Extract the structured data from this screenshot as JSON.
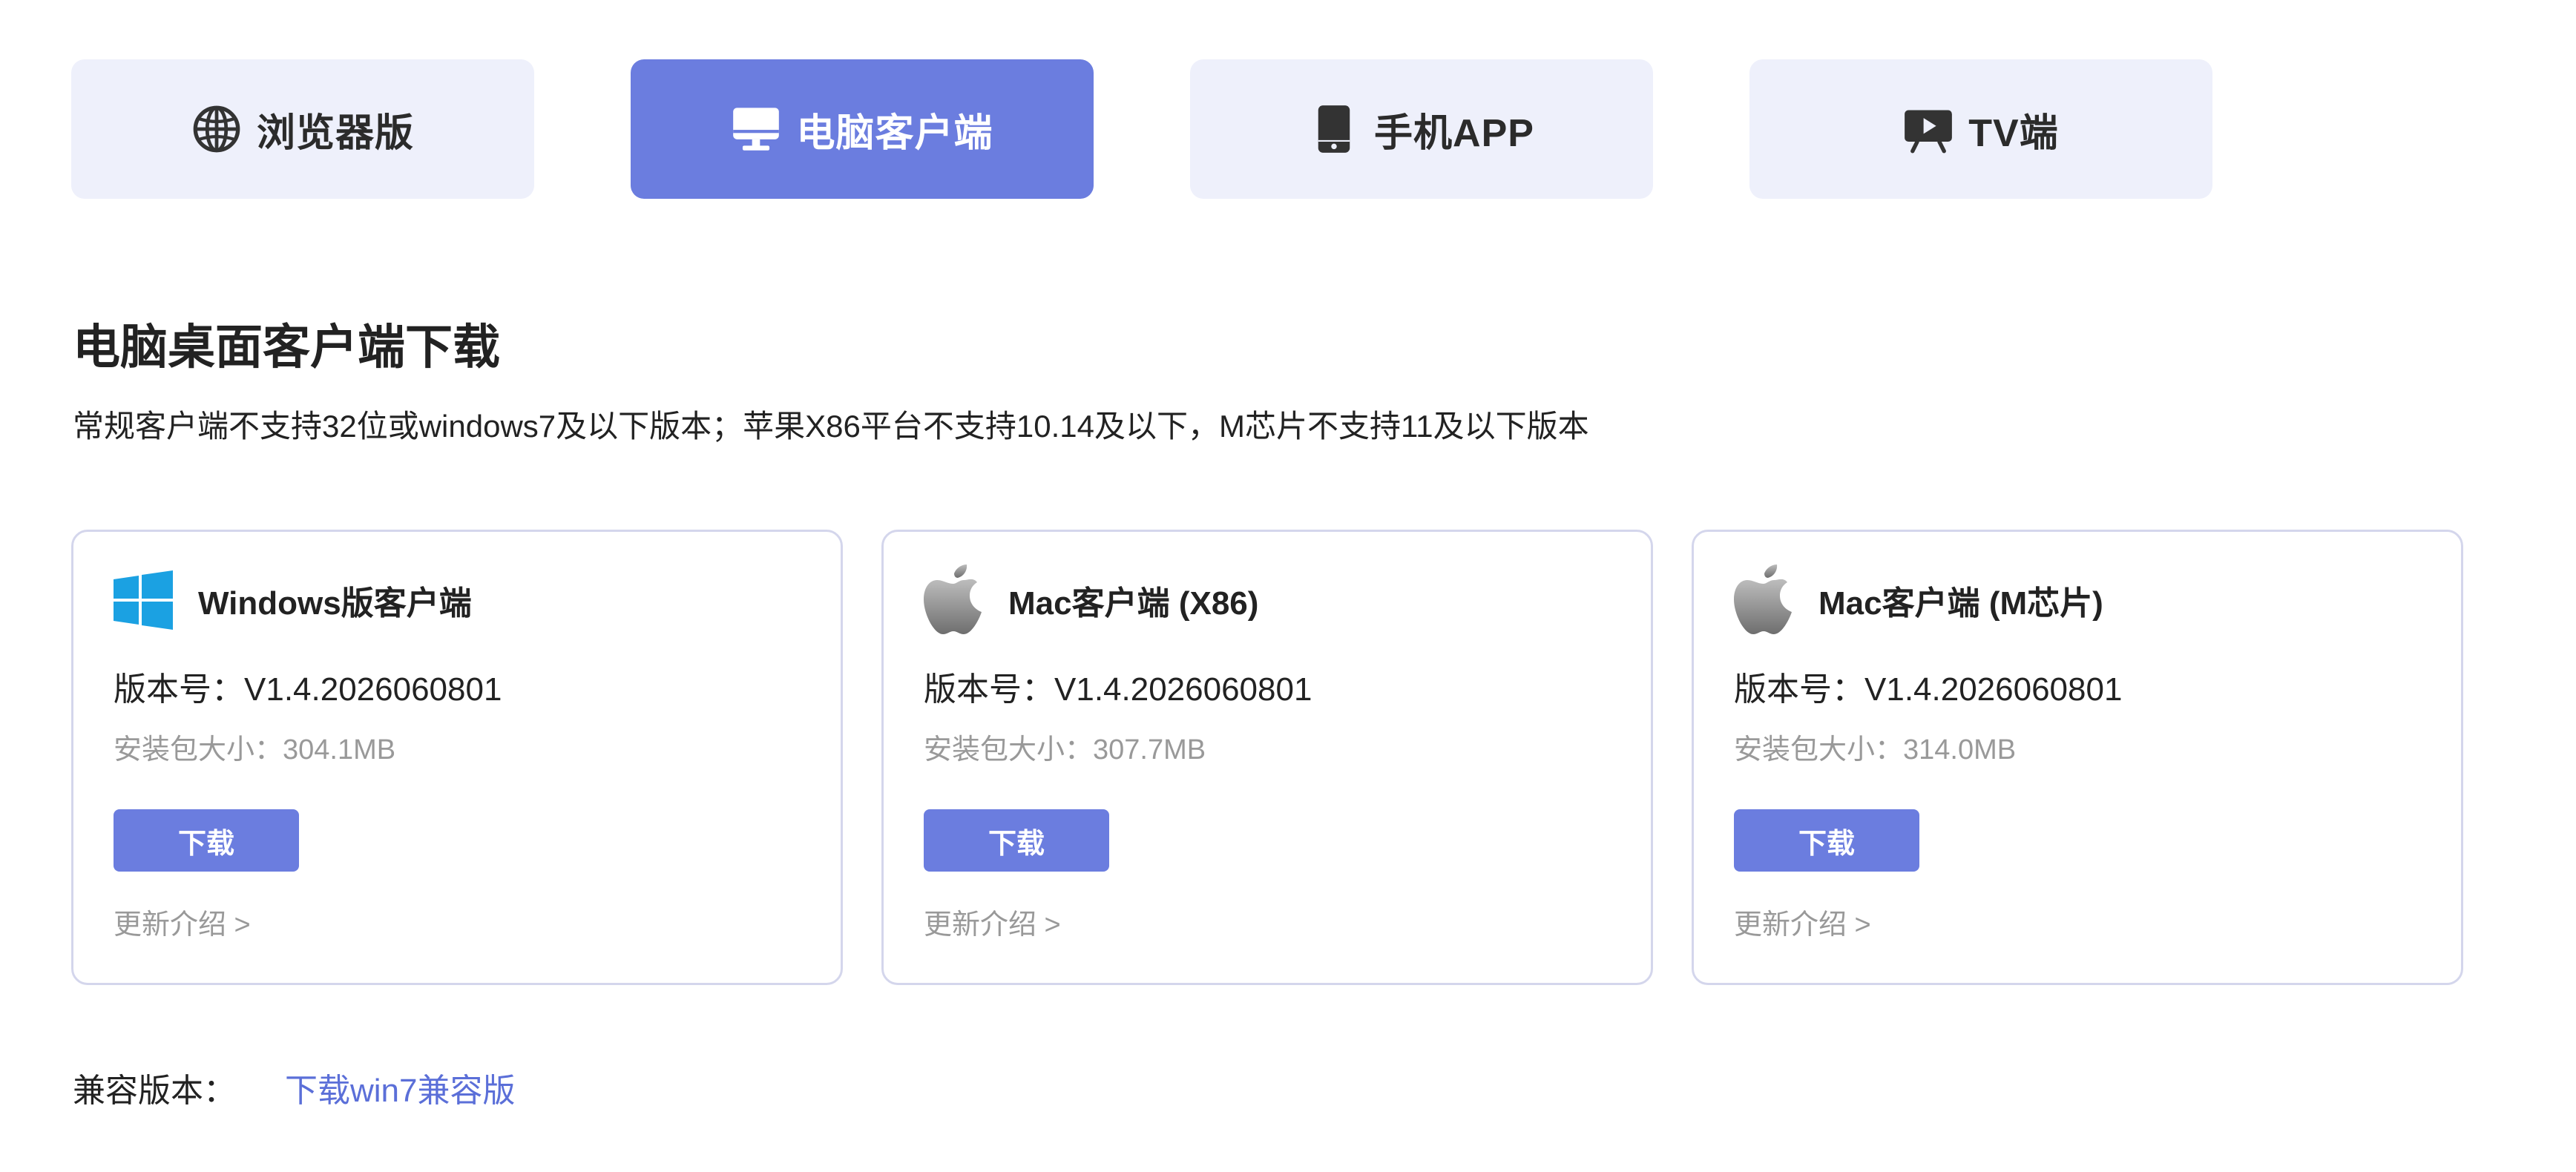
{
  "colors": {
    "accent": "#6b7ddf",
    "tab_bg": "#eef0fb",
    "card_border": "#d4d6ec",
    "muted_text": "#999999",
    "link": "#5b6fd8",
    "windows_blue": "#1ba1e2"
  },
  "tabs": [
    {
      "label": "浏览器版",
      "icon": "globe-icon",
      "active": false
    },
    {
      "label": "电脑客户端",
      "icon": "monitor-icon",
      "active": true
    },
    {
      "label": "手机APP",
      "icon": "phone-icon",
      "active": false
    },
    {
      "label": "TV端",
      "icon": "tv-icon",
      "active": false
    }
  ],
  "section": {
    "title": "电脑桌面客户端下载",
    "note": "常规客户端不支持32位或windows7及以下版本；苹果X86平台不支持10.14及以下，M芯片不支持11及以下版本"
  },
  "cards": [
    {
      "name": "Windows版客户端",
      "icon": "windows-logo-icon",
      "version": "版本号：V1.4.2026060801",
      "size": "安装包大小：304.1MB",
      "download_label": "下载",
      "notes_label": "更新介绍 >"
    },
    {
      "name": "Mac客户端 (X86)",
      "icon": "apple-logo-icon",
      "version": "版本号：V1.4.2026060801",
      "size": "安装包大小：307.7MB",
      "download_label": "下载",
      "notes_label": "更新介绍 >"
    },
    {
      "name": "Mac客户端 (M芯片)",
      "icon": "apple-logo-icon",
      "version": "版本号：V1.4.2026060801",
      "size": "安装包大小：314.0MB",
      "download_label": "下载",
      "notes_label": "更新介绍 >"
    }
  ],
  "compat": {
    "label": "兼容版本：",
    "link_label": "下载win7兼容版"
  }
}
